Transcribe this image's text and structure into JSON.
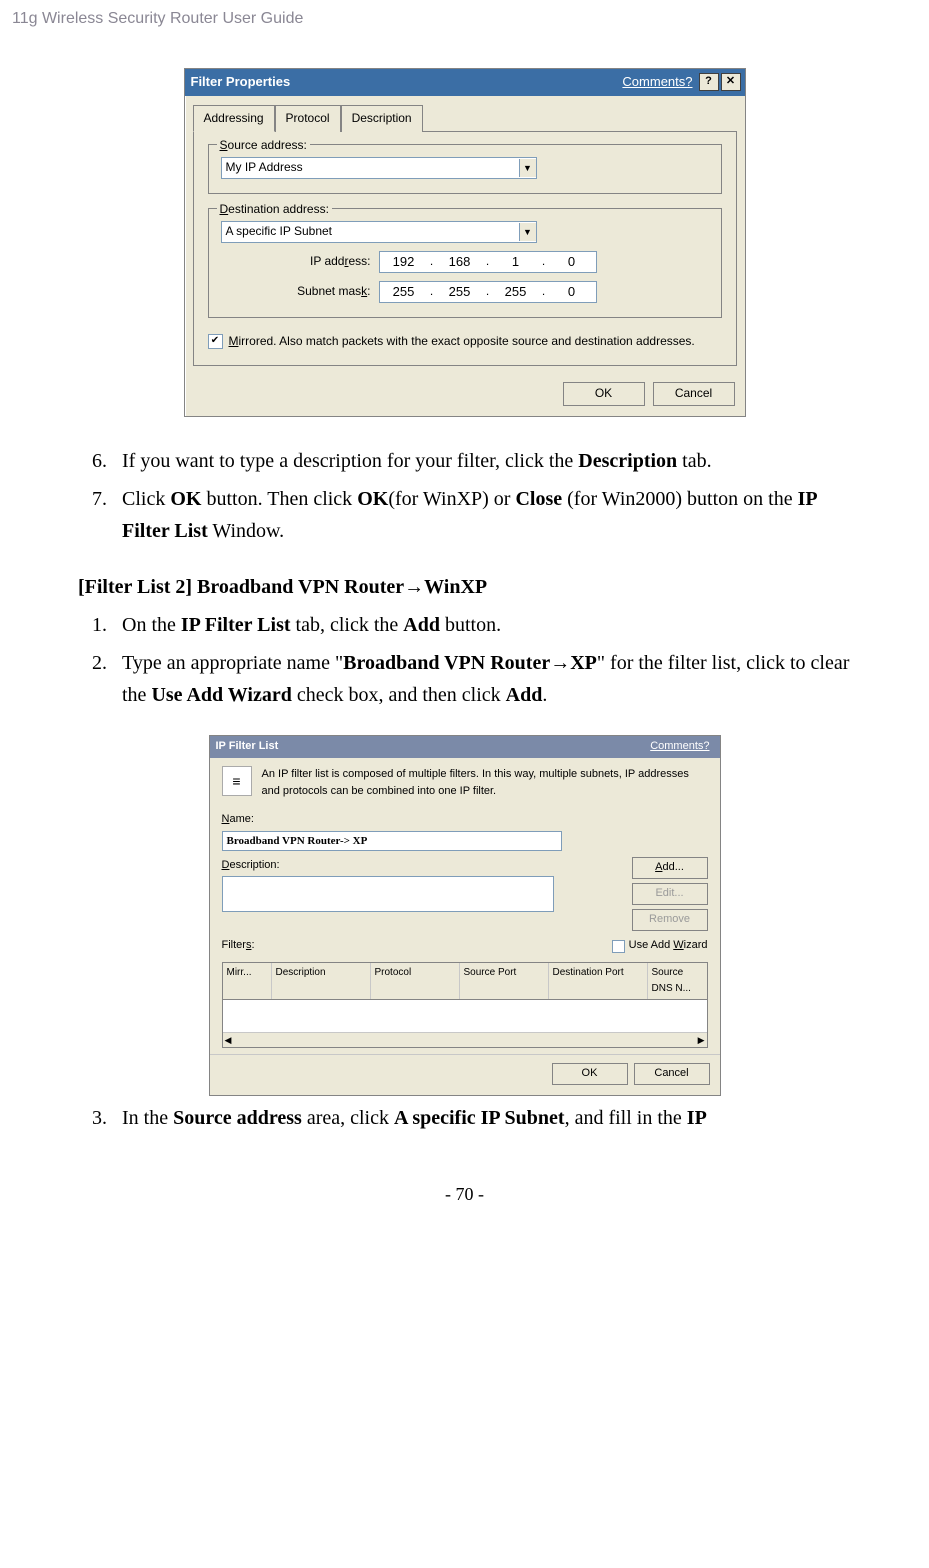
{
  "header": "11g Wireless Security Router User Guide",
  "dialog1": {
    "title": "Filter Properties",
    "comments": "Comments?",
    "help_btn": "?",
    "close_btn": "✕",
    "tabs": {
      "addressing": "Addressing",
      "protocol": "Protocol",
      "description": "Description"
    },
    "source": {
      "group": "Source address:",
      "value": "My IP Address"
    },
    "dest": {
      "group": "Destination address:",
      "value": "A specific IP Subnet",
      "ip_label": "IP address:",
      "mask_label": "Subnet mask:",
      "ip": {
        "o1": "192",
        "o2": "168",
        "o3": "1",
        "o4": "0"
      },
      "mask": {
        "o1": "255",
        "o2": "255",
        "o3": "255",
        "o4": "0"
      }
    },
    "mirrored": "Mirrored. Also match packets with the exact opposite source and destination addresses.",
    "ok": "OK",
    "cancel": "Cancel"
  },
  "steps1": {
    "s6a": "If you want to type a description for your filter, click the ",
    "s6b": "Description",
    "s6c": " tab.",
    "s7a": "Click ",
    "s7b": "OK",
    "s7c": " button. Then click ",
    "s7d": "OK",
    "s7e": "(for WinXP) or ",
    "s7f": "Close",
    "s7g": " (for Win2000) button on the ",
    "s7h": "IP Filter List",
    "s7i": " Window."
  },
  "filterlist2": {
    "title_a": "[Filter List 2]  Broadband VPN Router",
    "title_b": "WinXP",
    "s1a": "On the ",
    "s1b": "IP Filter List",
    "s1c": " tab, click the ",
    "s1d": "Add",
    "s1e": " button.",
    "s2a": "Type an appropriate name \"",
    "s2b": "Broadband VPN Router",
    "s2c": "XP",
    "s2d": "\" for the filter list, click to clear the ",
    "s2e": "Use Add Wizard",
    "s2f": " check box, and then click ",
    "s2g": "Add",
    "s2h": "."
  },
  "dialog2": {
    "title": "IP Filter List",
    "comments": "Comments?",
    "desc": "An IP filter list is composed of multiple filters. In this way, multiple subnets, IP addresses and protocols can be combined into one IP filter.",
    "name_label": "Name:",
    "name_value": "Broadband VPN Router-> XP",
    "description_label": "Description:",
    "add": "Add...",
    "edit": "Edit...",
    "remove": "Remove",
    "wizard": "Use Add Wizard",
    "filters_label": "Filters:",
    "cols": {
      "mirr": "Mirr...",
      "desc": "Description",
      "proto": "Protocol",
      "sport": "Source Port",
      "dport": "Destination Port",
      "sdns": "Source DNS N..."
    },
    "ok": "OK",
    "cancel": "Cancel"
  },
  "step3": {
    "a": "In the ",
    "b": "Source address",
    "c": " area, click ",
    "d": "A specific IP Subnet",
    "e": ", and fill in the ",
    "f": "IP"
  },
  "page_num": "- 70 -"
}
